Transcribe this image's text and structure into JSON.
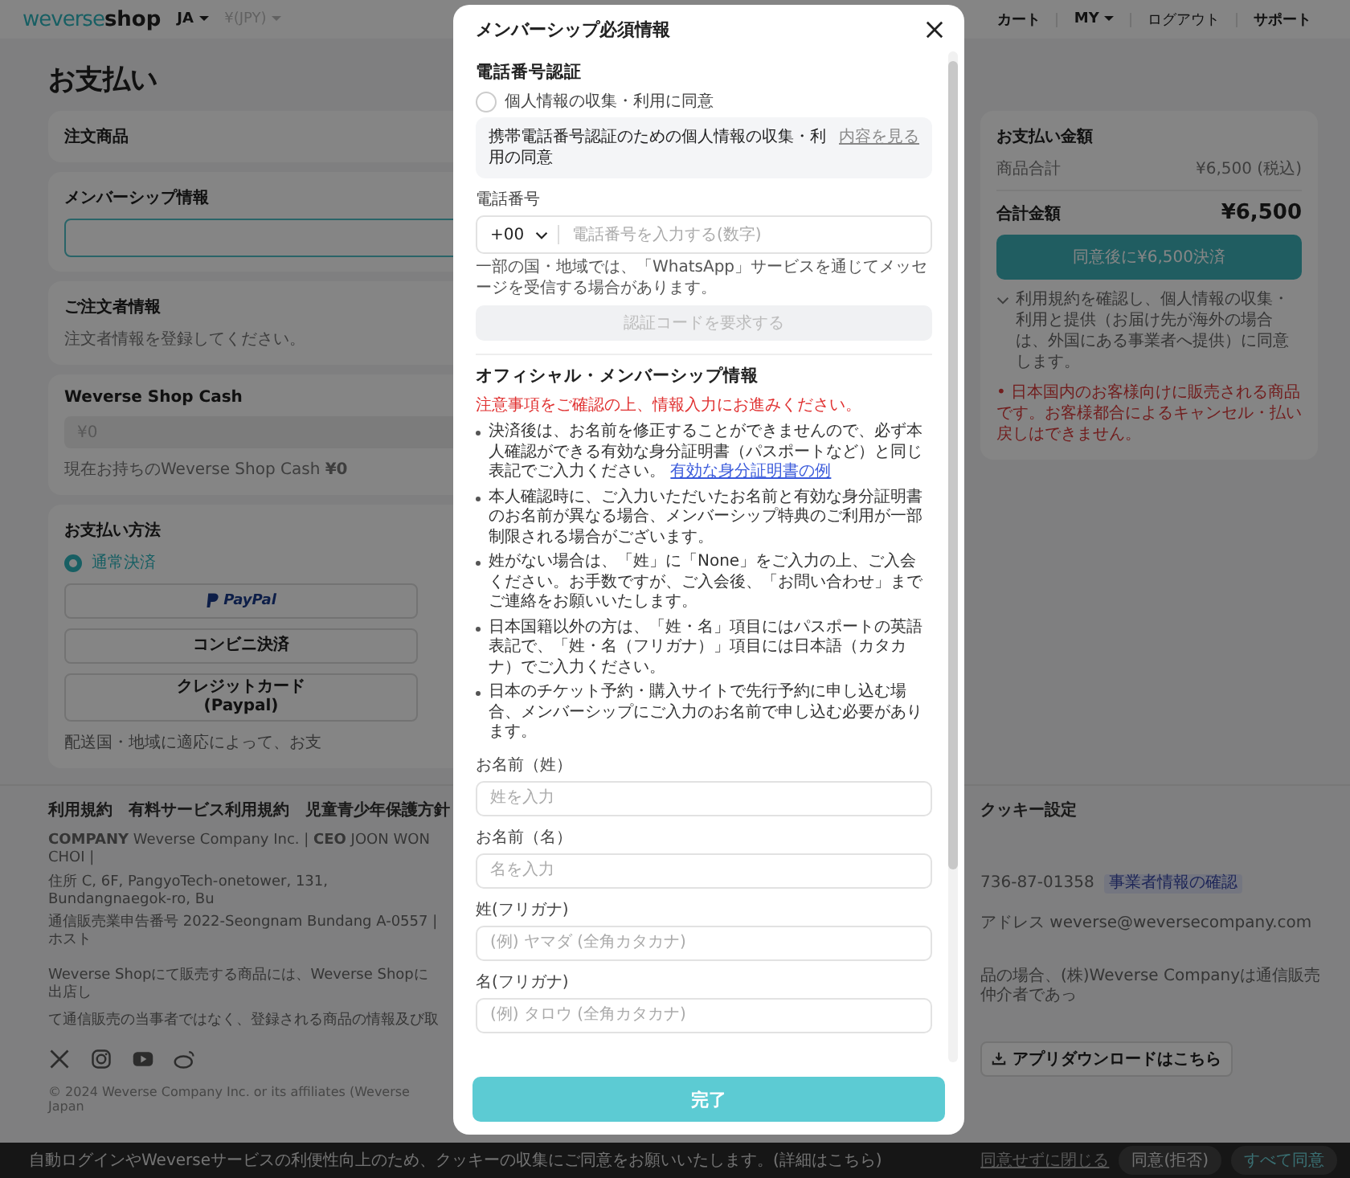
{
  "header": {
    "logo_mark": "weverse",
    "logo_text": "shop",
    "language": "JA",
    "currency": "¥(JPY)",
    "nav": [
      {
        "label": "カート",
        "dropdown": false
      },
      {
        "label": "MY",
        "dropdown": true
      },
      {
        "label": "ログアウト",
        "dropdown": false
      },
      {
        "label": "サポート",
        "dropdown": false
      }
    ]
  },
  "page_title": "お支払い",
  "sections": [
    {
      "kind": "plain",
      "title": "注文商品"
    },
    {
      "kind": "button",
      "title": "メンバーシップ情報"
    },
    {
      "kind": "text",
      "title": "ご注文者情報",
      "text": "注文者情報を登録してください。"
    },
    {
      "kind": "cash",
      "title": "Weverse Shop Cash",
      "placeholder": "¥0",
      "balance": "現在お持ちのWeverse Shop Cash **¥0**"
    },
    {
      "kind": "payment",
      "title": "お支払い方法",
      "methods": [
        {
          "label": "通常決済",
          "selected": true
        }
      ],
      "options": [
        {
          "kind": "logo",
          "label": "PayPal"
        },
        {
          "kind": "text",
          "label": "コンビニ決済"
        },
        {
          "kind": "text",
          "label": "クレジットカード\n(Paypal)"
        }
      ],
      "note": "配送国・地域に適応によって、お支"
    }
  ],
  "summary": {
    "title": "お支払い金額",
    "subtotal_label": "商品合計",
    "subtotal": "¥6,500 (税込)",
    "total_label": "合計金額",
    "total": "¥6,500",
    "pay_button": "同意後に¥6,500決済",
    "agree_note": "利用規約を確認し、個人情報の収集・利用と提供（お届け先が海外の場合は、外国にある事業者へ提供）に同意します。",
    "warning": "• 日本国内のお客様向けに販売される商品です。お客様都合によるキャンセル・払い戻しはできません。"
  },
  "footer": {
    "links": [
      "利用規約",
      "有料サービス利用規約",
      "児童青少年保護方針"
    ],
    "links_right": [
      "クッキー設定"
    ],
    "company_lines": [
      {
        "left": "**COMPANY** Weverse Company Inc. | **CEO** JOON WON CHOI |"
      },
      {
        "left": "住所 C, 6F, PangyoTech-onetower, 131, Bundangnaegok-ro, Bu",
        "right": "736-87-01358",
        "badge": "事業者情報の確認"
      },
      {
        "left": "通信販売業申告番号 2022-Seongnam Bundang A-0557 | ホスト",
        "right": "アドレス weverse@weversecompany.com"
      }
    ],
    "disclaimer_lines": [
      {
        "left": "Weverse Shopにて販売する商品には、Weverse Shopに出店し",
        "right": "品の場合、(株)Weverse Companyは通信販売仲介者であっ"
      },
      {
        "left": "て通信販売の当事者ではなく、登録される商品の情報及び取"
      }
    ],
    "app_button": "アプリダウンロードはこちら",
    "copyright": "© 2024 Weverse Company Inc. or its affiliates (Weverse Japan"
  },
  "cookie_bar": {
    "text": "自動ログインやWeverseサービスの利便性向上のため、クッキーの収集にご同意をお願いいたします。",
    "link": "(詳細はこちら)",
    "close_link": "同意せずに閉じる",
    "buttons": [
      {
        "label": "同意(拒否)",
        "primary": false
      },
      {
        "label": "すべて同意",
        "primary": true
      }
    ]
  },
  "modal": {
    "title": "メンバーシップ必須情報",
    "phone_section": {
      "title": "電話番号認証",
      "consent": {
        "label": "個人情報の収集・利用に同意",
        "checked": false
      },
      "consent_detail": "携帯電話番号認証のための個人情報の収集・利用の同意",
      "consent_link": "内容を見る",
      "phone_label": "電話番号",
      "country_code": "+00",
      "phone_placeholder": "電話番号を入力する(数字)",
      "note": "一部の国・地域では、「WhatsApp」サービスを通じてメッセージを受信する場合があります。",
      "request_button": {
        "label": "認証コードを要求する",
        "disabled": true
      }
    },
    "member_section": {
      "title": "オフィシャル・メンバーシップ情報",
      "notice": "注意事項をご確認の上、情報入力にお進みください。",
      "bullets": [
        {
          "text": "決済後は、お名前を修正することができませんので、必ず本人確認ができる有効な身分証明書（パスポートなど）と同じ表記でご入力ください。",
          "link": "有効な身分証明書の例"
        },
        {
          "text": "本人確認時に、ご入力いただいたお名前と有効な身分証明書のお名前が異なる場合、メンバーシップ特典のご利用が一部制限される場合がございます。"
        },
        {
          "text": "姓がない場合は、「姓」に「None」をご入力の上、ご入会ください。お手数ですが、ご入会後、「お問い合わせ」までご連絡をお願いいたします。"
        },
        {
          "text": "日本国籍以外の方は、「姓・名」項目にはパスポートの英語表記で、「姓・名（フリガナ）」項目には日本語（カタカナ）でご入力ください。"
        },
        {
          "text": "日本のチケット予約・購入サイトで先行予約に申し込む場合、メンバーシップにご入力のお名前で申し込む必要があります。"
        }
      ],
      "fields": [
        {
          "label": "お名前（姓）",
          "placeholder": "姓を入力"
        },
        {
          "label": "お名前（名）",
          "placeholder": "名を入力"
        },
        {
          "label": "姓(フリガナ)",
          "placeholder": "(例) ヤマダ (全角カタカナ)"
        },
        {
          "label": "名(フリガナ)",
          "placeholder": "(例) タロウ (全角カタカナ)"
        }
      ]
    },
    "submit": "完了"
  }
}
